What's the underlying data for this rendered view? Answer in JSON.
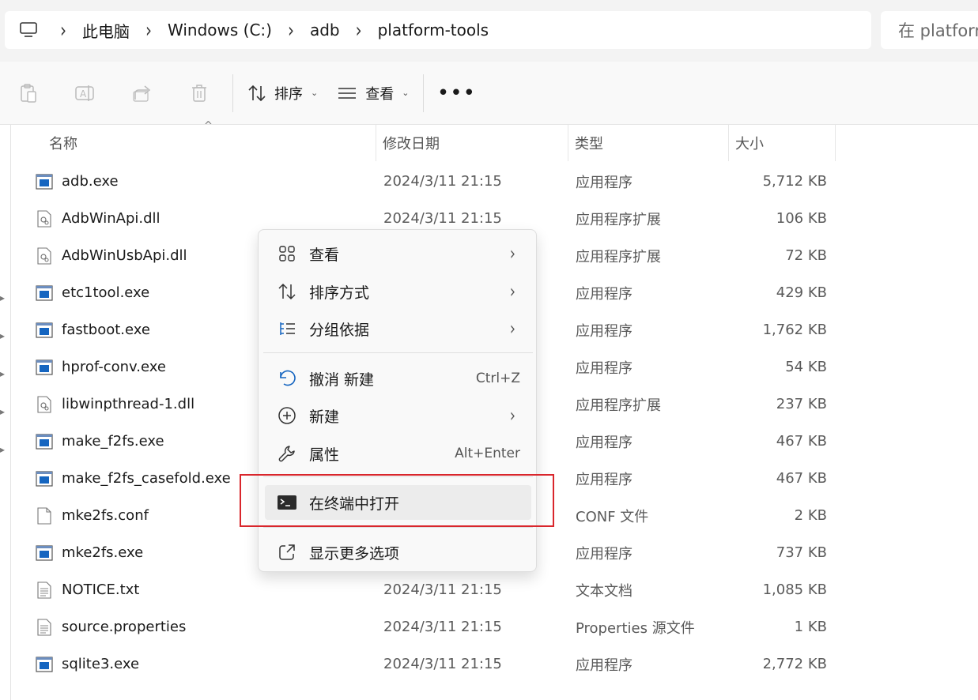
{
  "address": {
    "crumbs": [
      "此电脑",
      "Windows (C:)",
      "adb",
      "platform-tools"
    ],
    "search_placeholder": "在 platform-tools 中搜索"
  },
  "toolbar": {
    "sort_label": "排序",
    "view_label": "查看",
    "more_label": "•••"
  },
  "columns": {
    "name": "名称",
    "date": "修改日期",
    "type": "类型",
    "size": "大小"
  },
  "files": [
    {
      "name": "adb.exe",
      "date": "2024/3/11 21:15",
      "type": "应用程序",
      "size": "5,712 KB",
      "icon": "exe-icon"
    },
    {
      "name": "AdbWinApi.dll",
      "date": "2024/3/11 21:15",
      "type": "应用程序扩展",
      "size": "106 KB",
      "icon": "dll-icon"
    },
    {
      "name": "AdbWinUsbApi.dll",
      "date": "",
      "type": "应用程序扩展",
      "size": "72 KB",
      "icon": "dll-icon"
    },
    {
      "name": "etc1tool.exe",
      "date": "",
      "type": "应用程序",
      "size": "429 KB",
      "icon": "exe-icon"
    },
    {
      "name": "fastboot.exe",
      "date": "",
      "type": "应用程序",
      "size": "1,762 KB",
      "icon": "exe-icon"
    },
    {
      "name": "hprof-conv.exe",
      "date": "",
      "type": "应用程序",
      "size": "54 KB",
      "icon": "exe-icon"
    },
    {
      "name": "libwinpthread-1.dll",
      "date": "",
      "type": "应用程序扩展",
      "size": "237 KB",
      "icon": "dll-icon"
    },
    {
      "name": "make_f2fs.exe",
      "date": "",
      "type": "应用程序",
      "size": "467 KB",
      "icon": "exe-icon"
    },
    {
      "name": "make_f2fs_casefold.exe",
      "date": "",
      "type": "应用程序",
      "size": "467 KB",
      "icon": "exe-icon"
    },
    {
      "name": "mke2fs.conf",
      "date": "",
      "type": "CONF 文件",
      "size": "2 KB",
      "icon": "file-icon"
    },
    {
      "name": "mke2fs.exe",
      "date": "",
      "type": "应用程序",
      "size": "737 KB",
      "icon": "exe-icon"
    },
    {
      "name": "NOTICE.txt",
      "date": "2024/3/11 21:15",
      "type": "文本文档",
      "size": "1,085 KB",
      "icon": "text-file-icon"
    },
    {
      "name": "source.properties",
      "date": "2024/3/11 21:15",
      "type": "Properties 源文件",
      "size": "1 KB",
      "icon": "text-file-icon"
    },
    {
      "name": "sqlite3.exe",
      "date": "2024/3/11 21:15",
      "type": "应用程序",
      "size": "2,772 KB",
      "icon": "exe-icon"
    }
  ],
  "context_menu": {
    "view": "查看",
    "sort_by": "排序方式",
    "group_by": "分组依据",
    "undo": "撤消 新建",
    "undo_shortcut": "Ctrl+Z",
    "new": "新建",
    "properties": "属性",
    "properties_shortcut": "Alt+Enter",
    "open_terminal": "在终端中打开",
    "more_options": "显示更多选项"
  },
  "colors": {
    "highlight_box": "#d9262c",
    "exe_icon_blue": "#1565c0"
  }
}
